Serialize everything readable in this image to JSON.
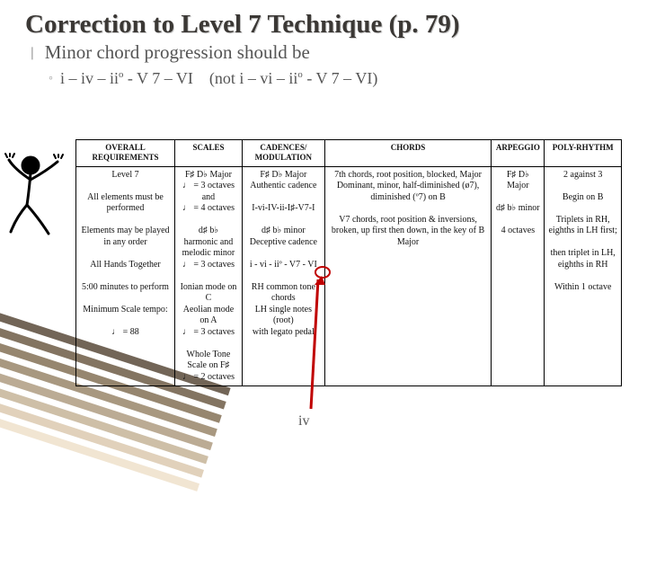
{
  "title": "Correction to Level 7 Technique (p. 79)",
  "bullet": "Minor chord progression should be",
  "sub_bullet_html": "i – iv – ii<sup>o</sup> - V 7 – VI (not i – vi – ii<sup>o</sup> - V 7 – VI)",
  "iv_label": "iv",
  "table": {
    "headers": [
      "OVERALL REQUIREMENTS",
      "SCALES",
      "CADENCES/ MODULATION",
      "CHORDS",
      "ARPEGGIO",
      "POLY-RHYTHM"
    ],
    "rows": [
      [
        "Level 7\n\nAll elements must be performed\n\nElements may be played in any order\n\nAll Hands Together\n\n5:00 minutes to perform\n\nMinimum Scale tempo:\n\n♩ = 88",
        "F♯ D♭ Major\n♩ = 3 octaves\nand\n♩ = 4 octaves\n\nd♯ b♭\nharmonic and melodic minor\n♩ = 3 octaves\n\nIonian mode on C\nAeolian mode on A\n♩ = 3 octaves\n\nWhole Tone Scale on F♯\n♩ = 2 octaves",
        "F♯ D♭ Major\nAuthentic cadence\n\nI-vi-IV-ii-I♯-V7-I\n\nd♯ b♭ minor\nDeceptive cadence\n\ni - vi - iiº - V7 - VI\n\nRH common tone chords\nLH single notes (root)\nwith legato pedal",
        "7th chords, root position, blocked, Major Dominant, minor, half-diminished (ø7), diminished (º7) on B\n\nV7 chords, root position & inversions, broken, up first then down, in the key of B Major",
        "F♯ D♭ Major\n\nd♯ b♭ minor\n\n4 octaves",
        "2 against 3\n\nBegin on B\n\nTriplets in RH, eighths in LH first;\n\nthen triplet in LH, eighths in RH\n\nWithin 1 octave"
      ]
    ]
  },
  "stripe_colors": [
    "#5a4b3a",
    "#6e5c46",
    "#847157",
    "#9a876b",
    "#b09d82",
    "#c6b498",
    "#dccab0",
    "#efe1cb"
  ]
}
